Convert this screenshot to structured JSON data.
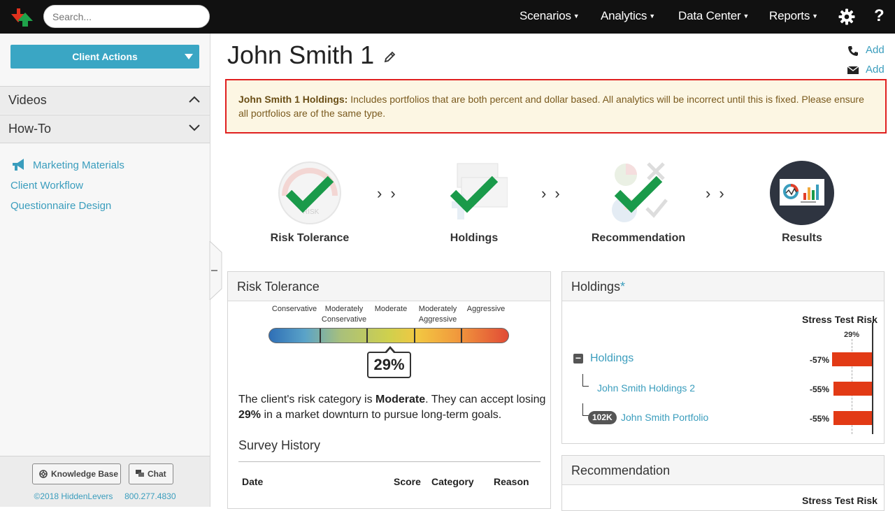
{
  "nav": {
    "search_placeholder": "Search...",
    "items": [
      {
        "label": "Scenarios"
      },
      {
        "label": "Analytics"
      },
      {
        "label": "Data Center"
      },
      {
        "label": "Reports"
      }
    ],
    "help": "?"
  },
  "sidebar": {
    "client_actions": "Client Actions",
    "sections": [
      {
        "label": "Videos"
      },
      {
        "label": "How-To"
      }
    ],
    "links": [
      {
        "label": "Marketing Materials"
      },
      {
        "label": "Client Workflow"
      },
      {
        "label": "Questionnaire Design"
      }
    ],
    "footer": {
      "knowledge_base": "Knowledge Base",
      "chat": "Chat",
      "copyright": "©2018 HiddenLevers",
      "phone": "800.277.4830"
    }
  },
  "header": {
    "client_name": "John Smith 1",
    "phone_add": "Add",
    "email_add": "Add"
  },
  "alert": {
    "bold": "John Smith 1 Holdings:",
    "text": " Includes portfolios that are both percent and dollar based. All analytics will be incorrect until this is fixed. Please ensure all portfolios are of the same type."
  },
  "steps": [
    {
      "label": "Risk Tolerance"
    },
    {
      "label": "Holdings"
    },
    {
      "label": "Recommendation"
    },
    {
      "label": "Results"
    }
  ],
  "risk_tolerance": {
    "title": "Risk Tolerance",
    "scale": [
      {
        "line1": "",
        "line2": "Conservative"
      },
      {
        "line1": "Moderately",
        "line2": "Conservative"
      },
      {
        "line1": "",
        "line2": "Moderate"
      },
      {
        "line1": "Moderately",
        "line2": "Aggressive"
      },
      {
        "line1": "",
        "line2": "Aggressive"
      }
    ],
    "score": "29%",
    "score_value": 29,
    "text_1": "The client's risk category is ",
    "text_bold_1": "Moderate",
    "text_2": ". They can accept losing ",
    "text_bold_2": "29%",
    "text_3": " in a market downturn to pursue long-term goals.",
    "survey_title": "Survey History",
    "survey_columns": [
      "Date",
      "Score",
      "Category",
      "Reason"
    ]
  },
  "holdings": {
    "title": "Holdings",
    "asterisk": "*",
    "col_header": "Stress Test Risk",
    "axis_label": "29%",
    "rows": [
      {
        "name": "Holdings",
        "pct": "-57%",
        "value": -57,
        "toggle": "−"
      },
      {
        "name": "John Smith Holdings 2",
        "pct": "-55%",
        "value": -55
      },
      {
        "name": "John Smith Portfolio",
        "pct": "-55%",
        "value": -55,
        "badge": "102K"
      }
    ]
  },
  "recommendation": {
    "title": "Recommendation",
    "col_header": "Stress Test Risk"
  },
  "colors": {
    "accent": "#3aa6c4",
    "link": "#3a9dbd",
    "alert_border": "#e02020",
    "alert_bg": "#fcf6e3",
    "check": "#1a9a4a",
    "bar_red": "#e23a15"
  },
  "icons": [
    "logo-icon",
    "gear-icon",
    "phone-icon",
    "email-icon",
    "edit-icon",
    "megaphone-icon",
    "chevron-up-icon",
    "chevron-down-icon",
    "lifebuoy-icon",
    "chat-icon",
    "checkmark-icon"
  ]
}
